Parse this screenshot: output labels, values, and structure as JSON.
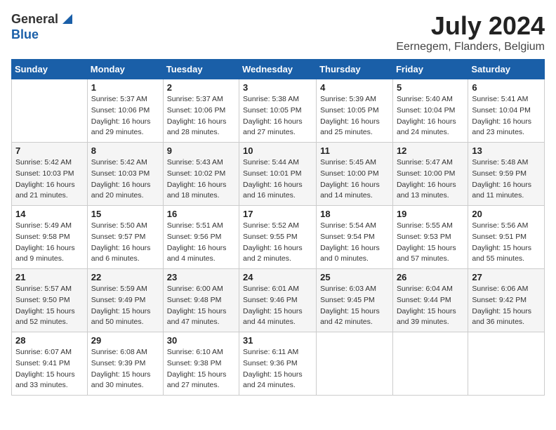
{
  "logo": {
    "general": "General",
    "blue": "Blue"
  },
  "header": {
    "month": "July 2024",
    "location": "Eernegem, Flanders, Belgium"
  },
  "weekdays": [
    "Sunday",
    "Monday",
    "Tuesday",
    "Wednesday",
    "Thursday",
    "Friday",
    "Saturday"
  ],
  "weeks": [
    [
      {
        "day": "",
        "info": ""
      },
      {
        "day": "1",
        "info": "Sunrise: 5:37 AM\nSunset: 10:06 PM\nDaylight: 16 hours\nand 29 minutes."
      },
      {
        "day": "2",
        "info": "Sunrise: 5:37 AM\nSunset: 10:06 PM\nDaylight: 16 hours\nand 28 minutes."
      },
      {
        "day": "3",
        "info": "Sunrise: 5:38 AM\nSunset: 10:05 PM\nDaylight: 16 hours\nand 27 minutes."
      },
      {
        "day": "4",
        "info": "Sunrise: 5:39 AM\nSunset: 10:05 PM\nDaylight: 16 hours\nand 25 minutes."
      },
      {
        "day": "5",
        "info": "Sunrise: 5:40 AM\nSunset: 10:04 PM\nDaylight: 16 hours\nand 24 minutes."
      },
      {
        "day": "6",
        "info": "Sunrise: 5:41 AM\nSunset: 10:04 PM\nDaylight: 16 hours\nand 23 minutes."
      }
    ],
    [
      {
        "day": "7",
        "info": "Sunrise: 5:42 AM\nSunset: 10:03 PM\nDaylight: 16 hours\nand 21 minutes."
      },
      {
        "day": "8",
        "info": "Sunrise: 5:42 AM\nSunset: 10:03 PM\nDaylight: 16 hours\nand 20 minutes."
      },
      {
        "day": "9",
        "info": "Sunrise: 5:43 AM\nSunset: 10:02 PM\nDaylight: 16 hours\nand 18 minutes."
      },
      {
        "day": "10",
        "info": "Sunrise: 5:44 AM\nSunset: 10:01 PM\nDaylight: 16 hours\nand 16 minutes."
      },
      {
        "day": "11",
        "info": "Sunrise: 5:45 AM\nSunset: 10:00 PM\nDaylight: 16 hours\nand 14 minutes."
      },
      {
        "day": "12",
        "info": "Sunrise: 5:47 AM\nSunset: 10:00 PM\nDaylight: 16 hours\nand 13 minutes."
      },
      {
        "day": "13",
        "info": "Sunrise: 5:48 AM\nSunset: 9:59 PM\nDaylight: 16 hours\nand 11 minutes."
      }
    ],
    [
      {
        "day": "14",
        "info": "Sunrise: 5:49 AM\nSunset: 9:58 PM\nDaylight: 16 hours\nand 9 minutes."
      },
      {
        "day": "15",
        "info": "Sunrise: 5:50 AM\nSunset: 9:57 PM\nDaylight: 16 hours\nand 6 minutes."
      },
      {
        "day": "16",
        "info": "Sunrise: 5:51 AM\nSunset: 9:56 PM\nDaylight: 16 hours\nand 4 minutes."
      },
      {
        "day": "17",
        "info": "Sunrise: 5:52 AM\nSunset: 9:55 PM\nDaylight: 16 hours\nand 2 minutes."
      },
      {
        "day": "18",
        "info": "Sunrise: 5:54 AM\nSunset: 9:54 PM\nDaylight: 16 hours\nand 0 minutes."
      },
      {
        "day": "19",
        "info": "Sunrise: 5:55 AM\nSunset: 9:53 PM\nDaylight: 15 hours\nand 57 minutes."
      },
      {
        "day": "20",
        "info": "Sunrise: 5:56 AM\nSunset: 9:51 PM\nDaylight: 15 hours\nand 55 minutes."
      }
    ],
    [
      {
        "day": "21",
        "info": "Sunrise: 5:57 AM\nSunset: 9:50 PM\nDaylight: 15 hours\nand 52 minutes."
      },
      {
        "day": "22",
        "info": "Sunrise: 5:59 AM\nSunset: 9:49 PM\nDaylight: 15 hours\nand 50 minutes."
      },
      {
        "day": "23",
        "info": "Sunrise: 6:00 AM\nSunset: 9:48 PM\nDaylight: 15 hours\nand 47 minutes."
      },
      {
        "day": "24",
        "info": "Sunrise: 6:01 AM\nSunset: 9:46 PM\nDaylight: 15 hours\nand 44 minutes."
      },
      {
        "day": "25",
        "info": "Sunrise: 6:03 AM\nSunset: 9:45 PM\nDaylight: 15 hours\nand 42 minutes."
      },
      {
        "day": "26",
        "info": "Sunrise: 6:04 AM\nSunset: 9:44 PM\nDaylight: 15 hours\nand 39 minutes."
      },
      {
        "day": "27",
        "info": "Sunrise: 6:06 AM\nSunset: 9:42 PM\nDaylight: 15 hours\nand 36 minutes."
      }
    ],
    [
      {
        "day": "28",
        "info": "Sunrise: 6:07 AM\nSunset: 9:41 PM\nDaylight: 15 hours\nand 33 minutes."
      },
      {
        "day": "29",
        "info": "Sunrise: 6:08 AM\nSunset: 9:39 PM\nDaylight: 15 hours\nand 30 minutes."
      },
      {
        "day": "30",
        "info": "Sunrise: 6:10 AM\nSunset: 9:38 PM\nDaylight: 15 hours\nand 27 minutes."
      },
      {
        "day": "31",
        "info": "Sunrise: 6:11 AM\nSunset: 9:36 PM\nDaylight: 15 hours\nand 24 minutes."
      },
      {
        "day": "",
        "info": ""
      },
      {
        "day": "",
        "info": ""
      },
      {
        "day": "",
        "info": ""
      }
    ]
  ]
}
